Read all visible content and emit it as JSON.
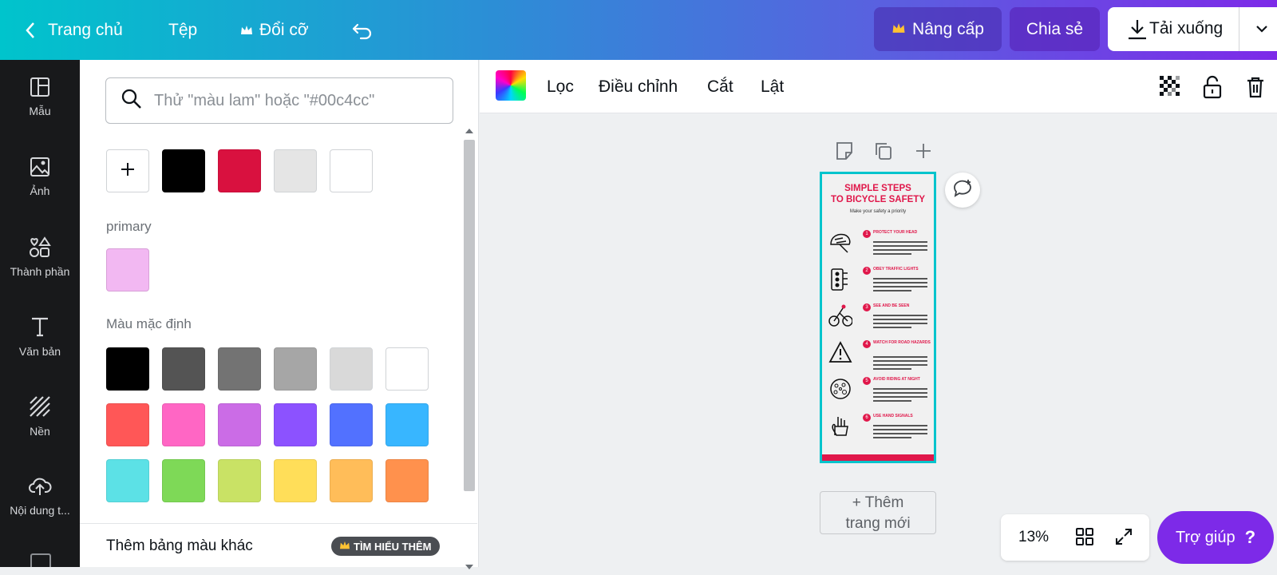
{
  "topbar": {
    "home_label": "Trang chủ",
    "file_label": "Tệp",
    "resize_label": "Đổi cỡ",
    "upgrade_label": "Nâng cấp",
    "share_label": "Chia sẻ",
    "download_label": "Tải xuống"
  },
  "sidebar": {
    "items": [
      {
        "label": "Mẫu",
        "icon": "template-icon"
      },
      {
        "label": "Ảnh",
        "icon": "image-icon"
      },
      {
        "label": "Thành phần",
        "icon": "elements-icon"
      },
      {
        "label": "Văn bản",
        "icon": "text-icon"
      },
      {
        "label": "Nền",
        "icon": "background-icon"
      },
      {
        "label": "Nội dung t...",
        "icon": "upload-cloud-icon"
      }
    ]
  },
  "panel": {
    "search_placeholder": "Thử \"màu lam\" hoặc \"#00c4cc\"",
    "document_colors": [
      "#000000",
      "#d9113f",
      "#e5e5e5",
      "#ffffff"
    ],
    "primary_label": "primary",
    "primary_colors": [
      "#f2b8f2"
    ],
    "default_label": "Màu mặc định",
    "default_colors": [
      "#000000",
      "#545454",
      "#737373",
      "#a6a6a6",
      "#d9d9d9",
      "#ffffff",
      "#ff5757",
      "#ff66c4",
      "#cb6ce6",
      "#8c52ff",
      "#5271ff",
      "#38b6ff",
      "#5ce1e6",
      "#7ed957",
      "#c9e265",
      "#ffde59",
      "#ffbd59",
      "#ff914d"
    ],
    "more_palettes_label": "Thêm bảng màu khác",
    "learn_more_label": "TÌM HIỂU THÊM"
  },
  "toolbar": {
    "filter_label": "Lọc",
    "adjust_label": "Điều chỉnh",
    "crop_label": "Cắt",
    "flip_label": "Lật"
  },
  "infographic": {
    "title_line1": "SIMPLE STEPS",
    "title_line2": "TO BICYCLE SAFETY",
    "subtitle": "Make your safety a priority",
    "steps": [
      {
        "num": "1",
        "head": "PROTECT YOUR HEAD"
      },
      {
        "num": "2",
        "head": "OBEY TRAFFIC LIGHTS"
      },
      {
        "num": "3",
        "head": "SEE AND BE SEEN"
      },
      {
        "num": "4",
        "head": "WATCH FOR ROAD HAZARDS"
      },
      {
        "num": "5",
        "head": "AVOID RIDING AT NIGHT"
      },
      {
        "num": "6",
        "head": "USE HAND SIGNALS"
      }
    ],
    "accent": "#e0174a"
  },
  "canvas": {
    "add_page_line1": "+ Thêm",
    "add_page_line2": "trang mới"
  },
  "footer": {
    "zoom": "13%",
    "help_label": "Trợ giúp"
  },
  "colors": {
    "accent_teal": "#00c4cc",
    "accent_purple": "#7d2ae8"
  }
}
